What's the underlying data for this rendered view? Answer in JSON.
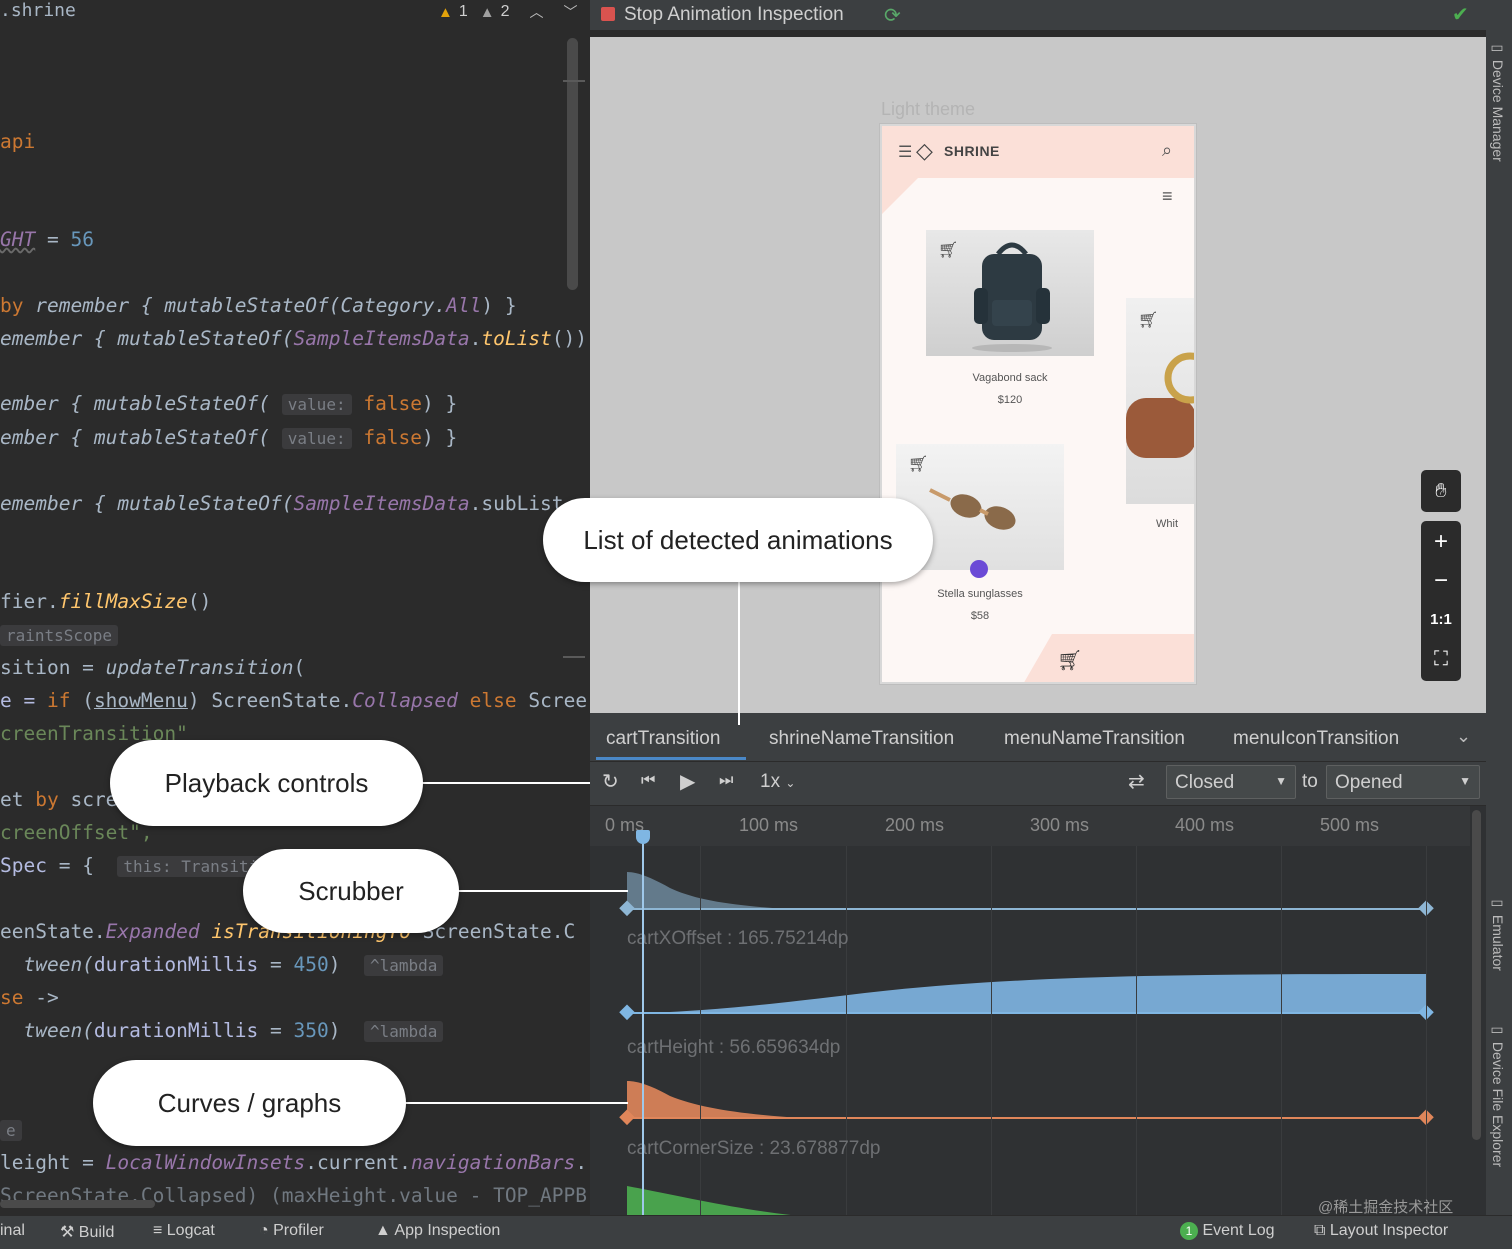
{
  "editor": {
    "filename": ".shrine",
    "warnings": {
      "yellow_count": "1",
      "grey_count": "2"
    },
    "lines": {
      "l1": "api",
      "l2_name": "GHT",
      "l2_eq": " = ",
      "l2_val": "56",
      "l3_by": "by",
      "l3_rest": " remember { mutableStateOf(Category.",
      "l3_all": "All",
      "l3_end": ") }",
      "l4_a": "emember { mutableStateOf(",
      "l4_b": "SampleItemsData",
      "l4_c": ".",
      "l4_d": "toList",
      "l4_e": "())",
      "l5_a": "ember { mutableStateOf(",
      "l5_hint": "value:",
      "l5_val": "false",
      "l5_end": ") }",
      "l6_a": "ember { mutableStateOf(",
      "l6_hint": "value:",
      "l6_val": "false",
      "l6_end": ") }",
      "l7_a": "emember { mutableStateOf(",
      "l7_b": "SampleItemsData",
      "l7_c": ".subList",
      "l8_a": "fier.",
      "l8_b": "fillMaxSize",
      "l8_c": "()",
      "l9_hint": "raintsScope",
      "l10_a": "sition = ",
      "l10_b": "updateTransition",
      "l10_c": "(",
      "l11_a": "e = ",
      "l11_if": "if",
      "l11_b": " (",
      "l11_c": "showMenu",
      "l11_d": ") ScreenState.",
      "l11_e": "Collapsed",
      "l11_else": " else ",
      "l11_f": "Scree",
      "l12": "creenTransition\"",
      "l13_a": "et ",
      "l13_by": "by",
      "l13_b": " scre",
      "l14": "creenOffset\",",
      "l15_a": "Spec",
      "l15_b": " = {",
      "l15_hint": "this: Transition.S",
      "l16_a": "eenState.",
      "l16_b": "Expanded",
      "l16_c": " isTransitioningTo",
      "l16_d": " ScreenState.C",
      "l17_a": "  tween(",
      "l17_b": "durationMillis",
      "l17_c": " = ",
      "l17_d": "450",
      "l17_e": ")",
      "l17_hint": "^lambda",
      "l18_a": "se",
      "l18_b": " ->",
      "l19_a": "  tween(",
      "l19_b": "durationMillis",
      "l19_c": " = ",
      "l19_d": "350",
      "l19_e": ")",
      "l19_hint": "^lambda",
      "l20": "e",
      "l21_a": "leight = ",
      "l21_b": "LocalWindowInsets",
      "l21_c": ".current.",
      "l21_d": "navigationBars",
      "l21_e": ".",
      "l22": "ScreenState.Collapsed) (maxHeight.value - TOP_APPB"
    }
  },
  "inspector": {
    "stop_label": "Stop Animation Inspection",
    "preview_theme_label": "Light theme",
    "app": {
      "title": "SHRINE",
      "products": [
        {
          "name": "Vagabond sack",
          "price": "$120"
        },
        {
          "name": "Stella sunglasses",
          "price": "$58"
        },
        {
          "name": "Whit",
          "price": ""
        }
      ]
    },
    "zoom": {
      "zoom_in": "+",
      "zoom_out": "−",
      "actual_size": "1:1"
    },
    "tabs": [
      {
        "label": "cartTransition"
      },
      {
        "label": "shrineNameTransition"
      },
      {
        "label": "menuNameTransition"
      },
      {
        "label": "menuIconTransition"
      }
    ],
    "playback": {
      "speed": "1x",
      "from_state": "Closed",
      "to_label": "to",
      "to_state": "Opened"
    },
    "timeline": {
      "ticks": [
        "0 ms",
        "100 ms",
        "200 ms",
        "300 ms",
        "400 ms",
        "500 ms"
      ],
      "properties": [
        {
          "label": "cartXOffset : 165.75214dp",
          "color": "#8eb6d4"
        },
        {
          "label": "cartHeight : 56.659634dp",
          "color": "#7fb6e3"
        },
        {
          "label": "cartCornerSize : 23.678877dp",
          "color": "#e0865a"
        },
        {
          "label": "",
          "color": "#4caf50"
        }
      ]
    }
  },
  "side_tabs": {
    "device_manager": "Device Manager",
    "emulator": "Emulator",
    "device_file_explorer": "Device File Explorer"
  },
  "bottom_bar": {
    "terminal": "inal",
    "build": "Build",
    "logcat": "Logcat",
    "profiler": "Profiler",
    "app_inspection": "App Inspection",
    "event_log": "Event Log",
    "layout_inspector": "Layout Inspector"
  },
  "callouts": {
    "animations_list": "List of detected animations",
    "playback": "Playback controls",
    "scrubber": "Scrubber",
    "curves": "Curves / graphs"
  },
  "watermark": "@稀土掘金技术社区",
  "colors": {
    "accent_blue": "#4a88c7",
    "stop_red": "#d9534f",
    "curve_blue": "#7fb6e3",
    "curve_orange": "#e0865a",
    "curve_green": "#4caf50"
  }
}
